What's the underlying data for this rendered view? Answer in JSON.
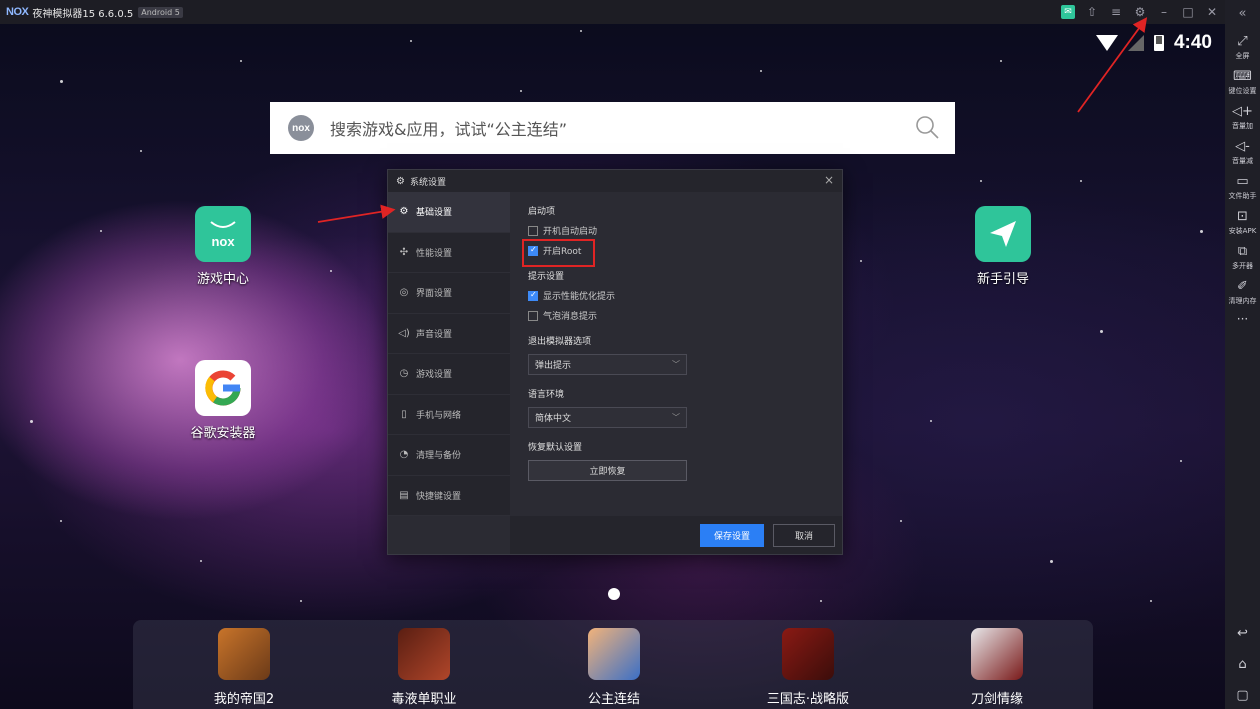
{
  "window": {
    "logo": "NOX",
    "title": "夜神模拟器15 6.6.0.5",
    "android_badge": "Android 5"
  },
  "status": {
    "time": "4:40"
  },
  "search": {
    "badge": "nox",
    "placeholder": "搜索游戏&应用，试试“公主连结”"
  },
  "sidebar": {
    "items": [
      {
        "label": "全屏",
        "icon": "fullscreen-icon"
      },
      {
        "label": "键位设置",
        "icon": "keyboard-icon"
      },
      {
        "label": "音量加",
        "icon": "volume-up-icon"
      },
      {
        "label": "音量减",
        "icon": "volume-down-icon"
      },
      {
        "label": "文件助手",
        "icon": "file-icon"
      },
      {
        "label": "安装APK",
        "icon": "apk-icon"
      },
      {
        "label": "多开器",
        "icon": "multi-instance-icon"
      },
      {
        "label": "清理内存",
        "icon": "broom-icon"
      }
    ]
  },
  "desktop": {
    "apps": [
      {
        "label": "游戏中心",
        "icon": "nox-game-center-icon",
        "color": "#2fc59a"
      },
      {
        "label": "谷歌安装器",
        "icon": "google-icon",
        "color": "#ffffff"
      },
      {
        "label": "新手引导",
        "icon": "paper-plane-icon",
        "color": "#2fc59a"
      }
    ]
  },
  "dock": {
    "apps": [
      {
        "label": "我的帝国2"
      },
      {
        "label": "毒液单职业"
      },
      {
        "label": "公主连结"
      },
      {
        "label": "三国志·战略版"
      },
      {
        "label": "刀剑情缘"
      }
    ]
  },
  "dialog": {
    "title": "系统设置",
    "nav": [
      {
        "label": "基础设置",
        "active": true
      },
      {
        "label": "性能设置",
        "active": false
      },
      {
        "label": "界面设置",
        "active": false
      },
      {
        "label": "声音设置",
        "active": false
      },
      {
        "label": "游戏设置",
        "active": false
      },
      {
        "label": "手机与网络",
        "active": false
      },
      {
        "label": "清理与备份",
        "active": false
      },
      {
        "label": "快捷键设置",
        "active": false
      }
    ],
    "startup": {
      "title": "启动项",
      "auto_start": {
        "label": "开机自动启动",
        "checked": false
      },
      "root": {
        "label": "开启Root",
        "checked": true
      }
    },
    "tips": {
      "title": "提示设置",
      "perf_tip": {
        "label": "显示性能优化提示",
        "checked": true
      },
      "bubble_tip": {
        "label": "气泡消息提示",
        "checked": false
      }
    },
    "exit": {
      "title": "退出模拟器选项",
      "value": "弹出提示"
    },
    "language": {
      "title": "语言环境",
      "value": "简体中文"
    },
    "restore": {
      "title": "恢复默认设置",
      "button": "立即恢复"
    },
    "save_button": "保存设置",
    "cancel_button": "取消"
  },
  "colors": {
    "accent": "#2b7ff5",
    "annotation": "#e02424",
    "nox_green": "#2fc59a"
  }
}
